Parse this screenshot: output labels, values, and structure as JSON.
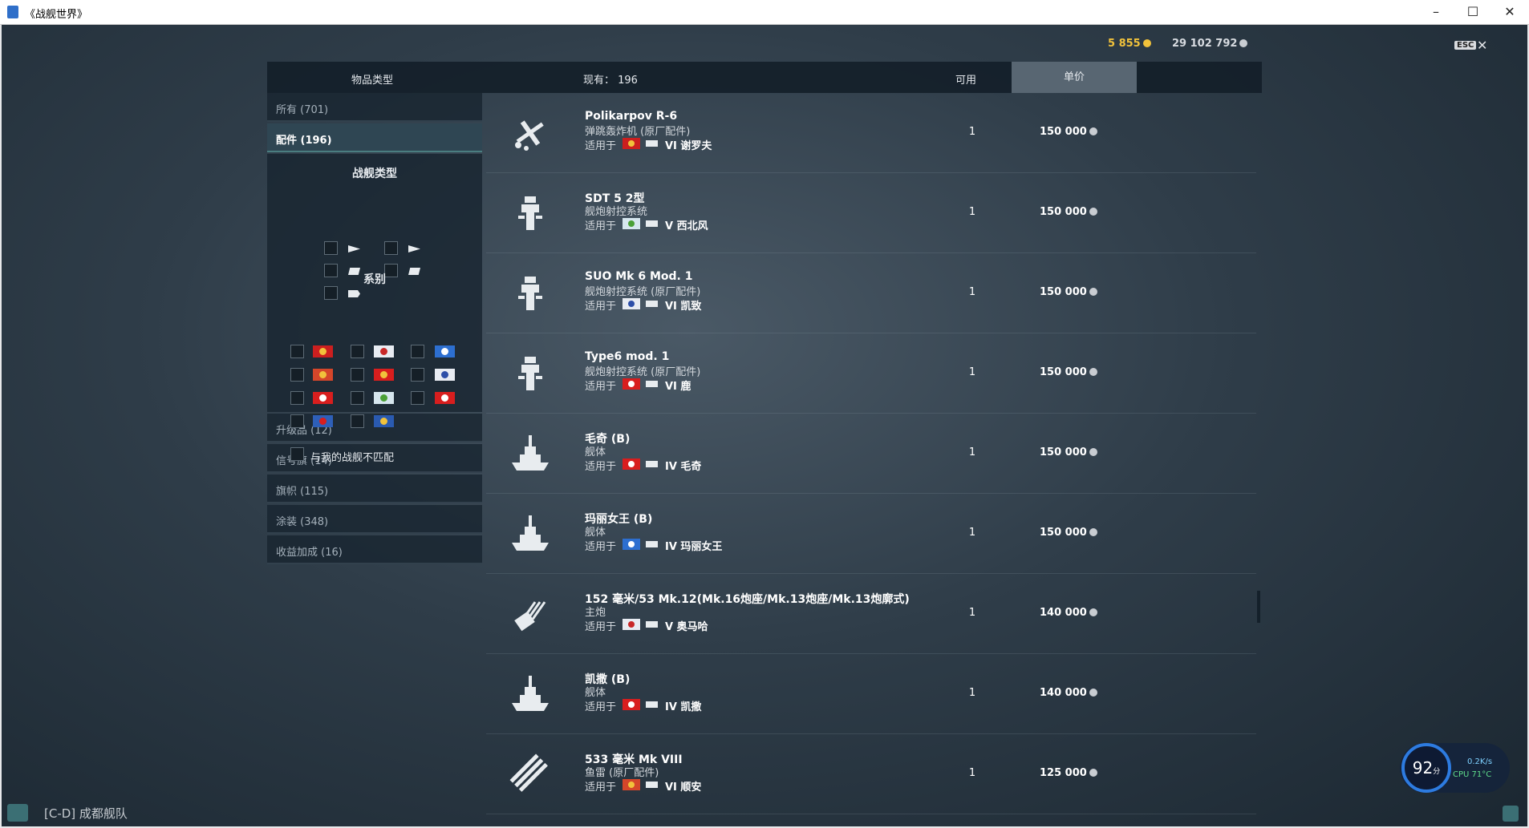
{
  "window": {
    "title": "《战舰世界》",
    "minimize": "–",
    "maximize": "☐",
    "close": "✕"
  },
  "currency": {
    "doubloons": "5 855",
    "credits": "29 102 792"
  },
  "esc": {
    "key": "ESC",
    "close": "✕"
  },
  "header": {
    "item_type": "物品类型",
    "have": "现有： 196",
    "available": "可用",
    "price": "单价"
  },
  "sidebar": {
    "all": "所有 (701)",
    "upgrades": "配件 (196)",
    "ship_type_title": "战舰类型",
    "nation_title": "系别",
    "mismatch": "与我的战舰不匹配",
    "categories": [
      "升级品 (12)",
      "信号旗 (14)",
      "旗帜 (115)",
      "涂装 (348)",
      "收益加成 (16)"
    ]
  },
  "rows": [
    {
      "name": "Polikarpov R-6",
      "sub": "弹跳轰炸机 (原厂配件)",
      "applies": "适用于",
      "ship": "VI 谢罗夫",
      "icon": "plane-icon",
      "flag": "#cc1f1f",
      "flag_mark": "#f1c23b",
      "qty": "1",
      "price": "150 000"
    },
    {
      "name": "SDT 5 2型",
      "sub": "舰炮射控系统",
      "applies": "适用于",
      "ship": "V 西北风",
      "icon": "fire-control-icon",
      "flag": "#d6e6ee",
      "flag_mark": "#4aa036",
      "qty": "1",
      "price": "150 000"
    },
    {
      "name": "SUO Mk 6 Mod. 1",
      "sub": "舰炮射控系统 (原厂配件)",
      "applies": "适用于",
      "ship": "VI 凯致",
      "icon": "fire-control-icon",
      "flag": "#e8ecf2",
      "flag_mark": "#2d4fa8",
      "qty": "1",
      "price": "150 000"
    },
    {
      "name": "Type6 mod. 1",
      "sub": "舰炮射控系统 (原厂配件)",
      "applies": "适用于",
      "ship": "VI 鹿",
      "icon": "fire-control-icon",
      "flag": "#d81e1e",
      "flag_mark": "#ffffff",
      "qty": "1",
      "price": "150 000"
    },
    {
      "name": "毛奇 (B)",
      "sub": "舰体",
      "applies": "适用于",
      "ship": "IV 毛奇",
      "icon": "hull-icon",
      "flag": "#d81e1e",
      "flag_mark": "#ffffff",
      "qty": "1",
      "price": "150 000"
    },
    {
      "name": "玛丽女王 (B)",
      "sub": "舰体",
      "applies": "适用于",
      "ship": "IV 玛丽女王",
      "icon": "hull-icon",
      "flag": "#2d6fd0",
      "flag_mark": "#ffffff",
      "qty": "1",
      "price": "150 000"
    },
    {
      "name": "152 毫米/53 Mk.12(Mk.16炮座/Mk.13炮座/Mk.13炮廓式)",
      "sub": "主炮",
      "applies": "适用于",
      "ship": "V 奥马哈",
      "icon": "main-gun-icon",
      "flag": "#e8ecf2",
      "flag_mark": "#c82828",
      "qty": "1",
      "price": "140 000"
    },
    {
      "name": "凯撒 (B)",
      "sub": "舰体",
      "applies": "适用于",
      "ship": "IV 凯撒",
      "icon": "hull-icon",
      "flag": "#d81e1e",
      "flag_mark": "#ffffff",
      "qty": "1",
      "price": "140 000"
    },
    {
      "name": "533 毫米 Mk VIII",
      "sub": "鱼雷 (原厂配件)",
      "applies": "适用于",
      "ship": "VI 顺安",
      "icon": "torpedo-icon",
      "flag": "#d5462a",
      "flag_mark": "#f1c23b",
      "qty": "1",
      "price": "125 000"
    }
  ],
  "bottom": {
    "clan": "[C-D]  成都舰队"
  },
  "widget": {
    "score": "92",
    "score_unit": "分",
    "net": "0.2K/s",
    "cpu": "CPU 71°C"
  },
  "colors": {
    "accent": "#f1c23b",
    "active_tab": "#2f4653",
    "price_header": "#586672"
  }
}
